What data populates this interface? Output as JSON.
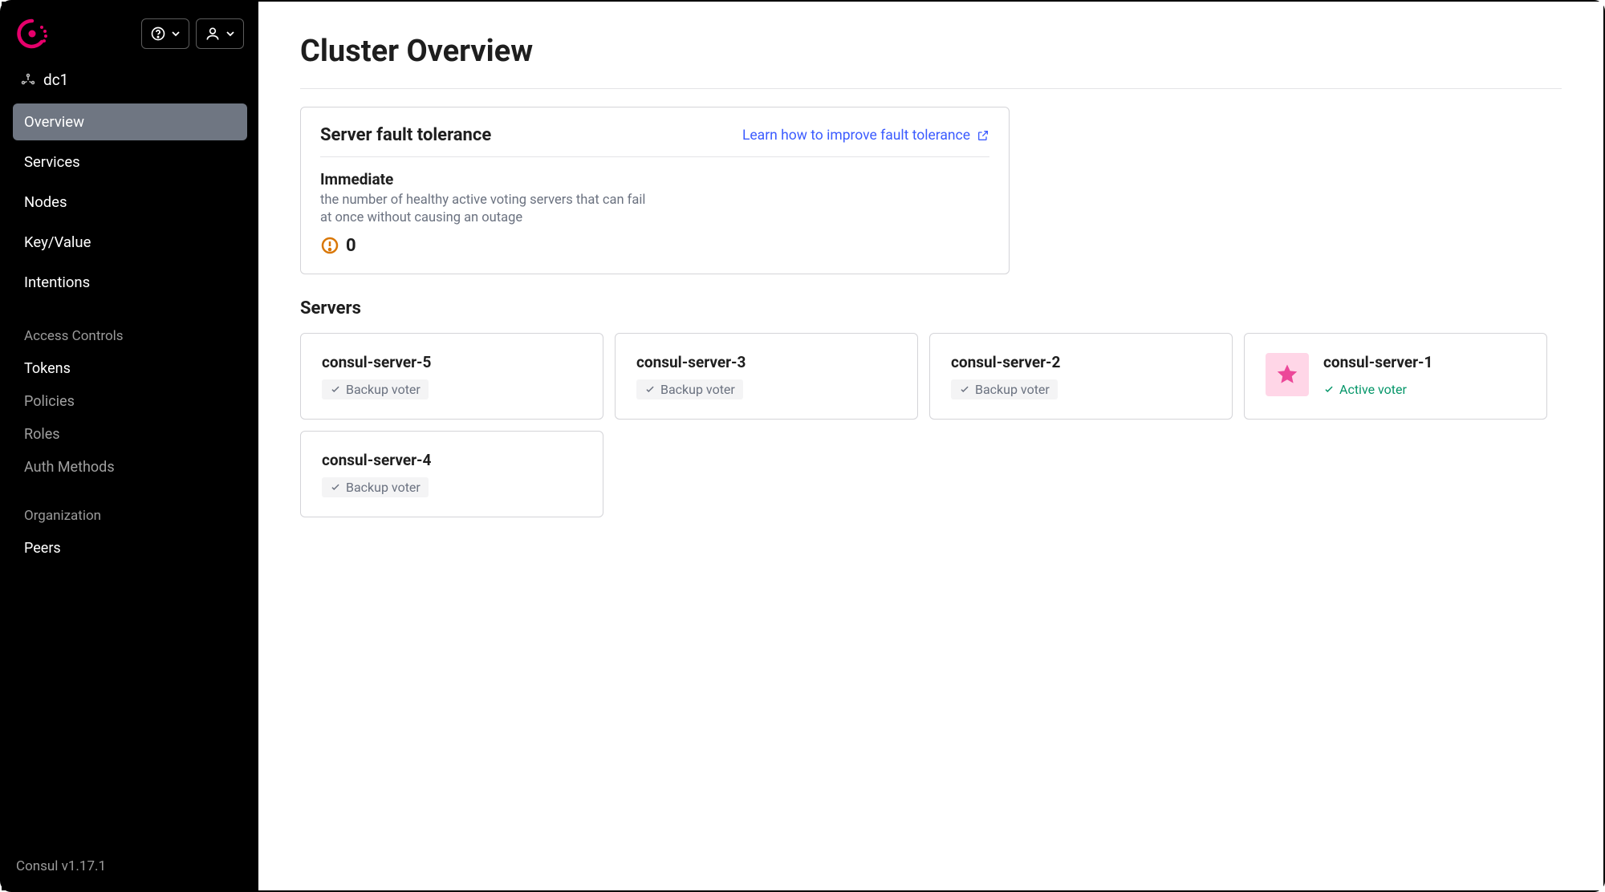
{
  "sidebar": {
    "datacenter": "dc1",
    "nav": [
      {
        "label": "Overview",
        "active": true
      },
      {
        "label": "Services",
        "active": false
      },
      {
        "label": "Nodes",
        "active": false
      },
      {
        "label": "Key/Value",
        "active": false
      },
      {
        "label": "Intentions",
        "active": false
      }
    ],
    "access_section": "Access Controls",
    "access_items": [
      {
        "label": "Tokens",
        "enabled": true
      },
      {
        "label": "Policies",
        "enabled": false
      },
      {
        "label": "Roles",
        "enabled": false
      },
      {
        "label": "Auth Methods",
        "enabled": false
      }
    ],
    "org_section": "Organization",
    "org_items": [
      {
        "label": "Peers",
        "enabled": true
      }
    ],
    "footer": "Consul v1.17.1"
  },
  "page": {
    "title": "Cluster Overview",
    "fault_card": {
      "title": "Server fault tolerance",
      "learn_link": "Learn how to improve fault tolerance",
      "stat_label": "Immediate",
      "stat_desc": "the number of healthy active voting servers that can fail at once without causing an outage",
      "stat_value": "0"
    },
    "servers_heading": "Servers",
    "servers": [
      {
        "name": "consul-server-5",
        "status": "Backup voter",
        "leader": false
      },
      {
        "name": "consul-server-3",
        "status": "Backup voter",
        "leader": false
      },
      {
        "name": "consul-server-2",
        "status": "Backup voter",
        "leader": false
      },
      {
        "name": "consul-server-1",
        "status": "Active voter",
        "leader": true
      },
      {
        "name": "consul-server-4",
        "status": "Backup voter",
        "leader": false
      }
    ]
  }
}
